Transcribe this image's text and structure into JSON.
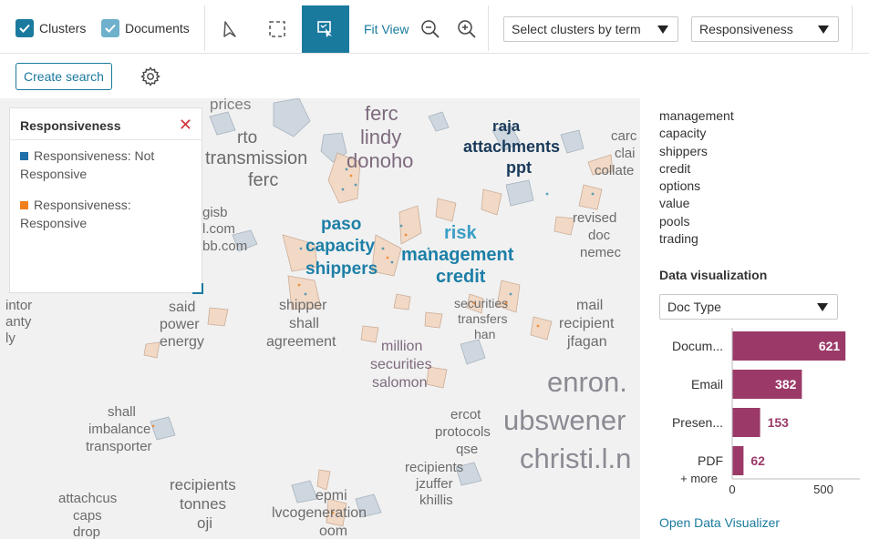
{
  "toolbar": {
    "clusters_label": "Clusters",
    "documents_label": "Documents",
    "fit_view_label": "Fit View",
    "cluster_select": "Select clusters by term",
    "color_select": "Responsiveness",
    "create_search_label": "Create search",
    "accent_color": "#1a7a9e"
  },
  "legend": {
    "title": "Responsiveness",
    "items": [
      {
        "label": "Responsiveness: Not Responsive",
        "color": "#1f6fa8"
      },
      {
        "label": "Responsiveness: Responsive",
        "color": "#f07f1a"
      }
    ]
  },
  "map_labels": {
    "prices": "prices",
    "ferc1": "ferc",
    "lindy": "lindy",
    "donoho": "donoho",
    "rto": "rto",
    "transmission": "transmission",
    "ferc2": "ferc",
    "raja": "raja",
    "attachments": "attachments",
    "ppt": "ppt",
    "carc": "carc",
    "clai": "clai",
    "collate": "collate",
    "gisb": "gisb",
    "lcom": "l.com",
    "bbcom": "bb.com",
    "paso": "paso",
    "capacity": "capacity",
    "shippers": "shippers",
    "risk": "risk",
    "management": "management",
    "credit": "credit",
    "revised": "revised",
    "doc": "doc",
    "nemec": "nemec",
    "intor": "intor",
    "anty": "anty",
    "ly": "ly",
    "said": "said",
    "power": "power",
    "energy": "energy",
    "shipper": "shipper",
    "shall1": "shall",
    "agreement": "agreement",
    "securities1": "securities",
    "transfers": "transfers",
    "han": "han",
    "mail": "mail",
    "recipient": "recipient",
    "jfagan": "jfagan",
    "million": "million",
    "securities2": "securities",
    "salomon": "salomon",
    "enron": "enron.",
    "ubswener": "ubswener",
    "christi": "christi.l.n",
    "shall2": "shall",
    "imbalance": "imbalance",
    "transporter": "transporter",
    "ercot": "ercot",
    "protocols": "protocols",
    "qse": "qse",
    "recipients1": "recipients",
    "jzuffer": "jzuffer",
    "khillis": "khillis",
    "recipients2": "recipients",
    "tonnes": "tonnes",
    "oji": "oji",
    "attachcus": "attachcus",
    "caps": "caps",
    "drop": "drop",
    "epmi": "epmi",
    "lvcogeneration": "lvcogeneration",
    "oom": "oom"
  },
  "terms": [
    "management",
    "capacity",
    "shippers",
    "credit",
    "options",
    "value",
    "pools",
    "trading"
  ],
  "data_visualization": {
    "title": "Data visualization",
    "select": "Doc Type",
    "more_label": "+ more",
    "link": "Open Data Visualizer"
  },
  "chart_data": {
    "type": "bar",
    "orientation": "horizontal",
    "categories": [
      "Docum...",
      "Email",
      "Presen...",
      "PDF"
    ],
    "values": [
      621,
      382,
      153,
      62
    ],
    "xlim": [
      0,
      700
    ],
    "xticks": [
      0,
      500
    ],
    "bar_color": "#9b3a68"
  }
}
